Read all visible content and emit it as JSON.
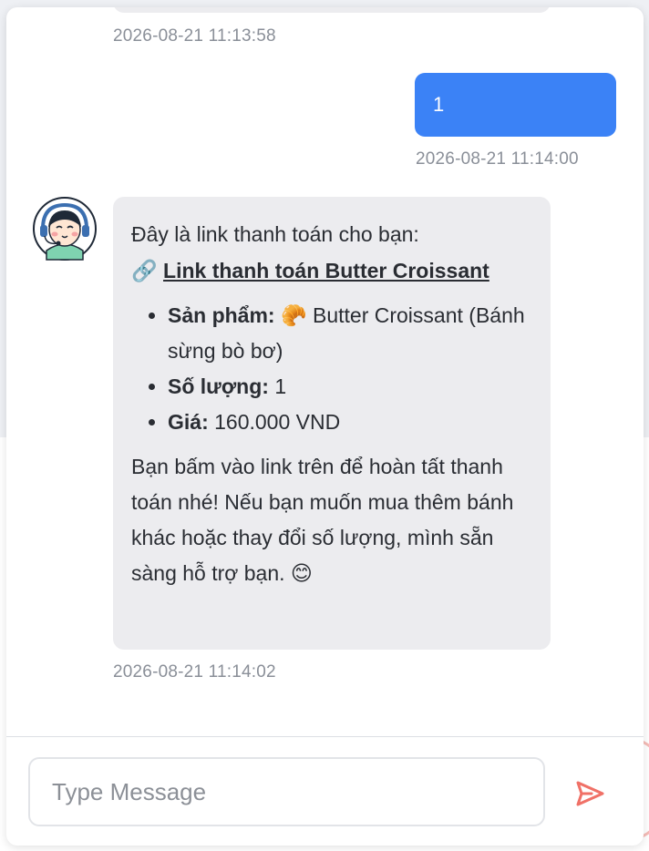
{
  "messages": {
    "previous_timestamp": "2026-08-21 11:13:58",
    "user_message": {
      "text": "1",
      "timestamp": "2026-08-21 11:14:00"
    },
    "bot_message": {
      "intro": "Đây là link thanh toán cho bạn:",
      "link_icon": "🔗",
      "link_text": "Link thanh toán Butter Croissant",
      "details": [
        {
          "label": "Sản phẩm:",
          "value": "🥐 Butter Croissant (Bánh sừng bò bơ)"
        },
        {
          "label": "Số lượng:",
          "value": "1"
        },
        {
          "label": "Giá:",
          "value": "160.000 VND"
        }
      ],
      "closing": "Bạn bấm vào link trên để hoàn tất thanh toán nhé! Nếu bạn muốn mua thêm bánh khác hoặc thay đổi số lượng, mình sẵn sàng hỗ trợ bạn. 😊",
      "timestamp": "2026-08-21 11:14:02"
    }
  },
  "composer": {
    "placeholder": "Type Message"
  },
  "icons": {
    "send": "send-icon",
    "avatar": "support-agent-avatar",
    "link": "link-icon"
  },
  "colors": {
    "user_bubble": "#3b82f6",
    "bot_bubble": "#ececef",
    "send": "#f07167"
  }
}
